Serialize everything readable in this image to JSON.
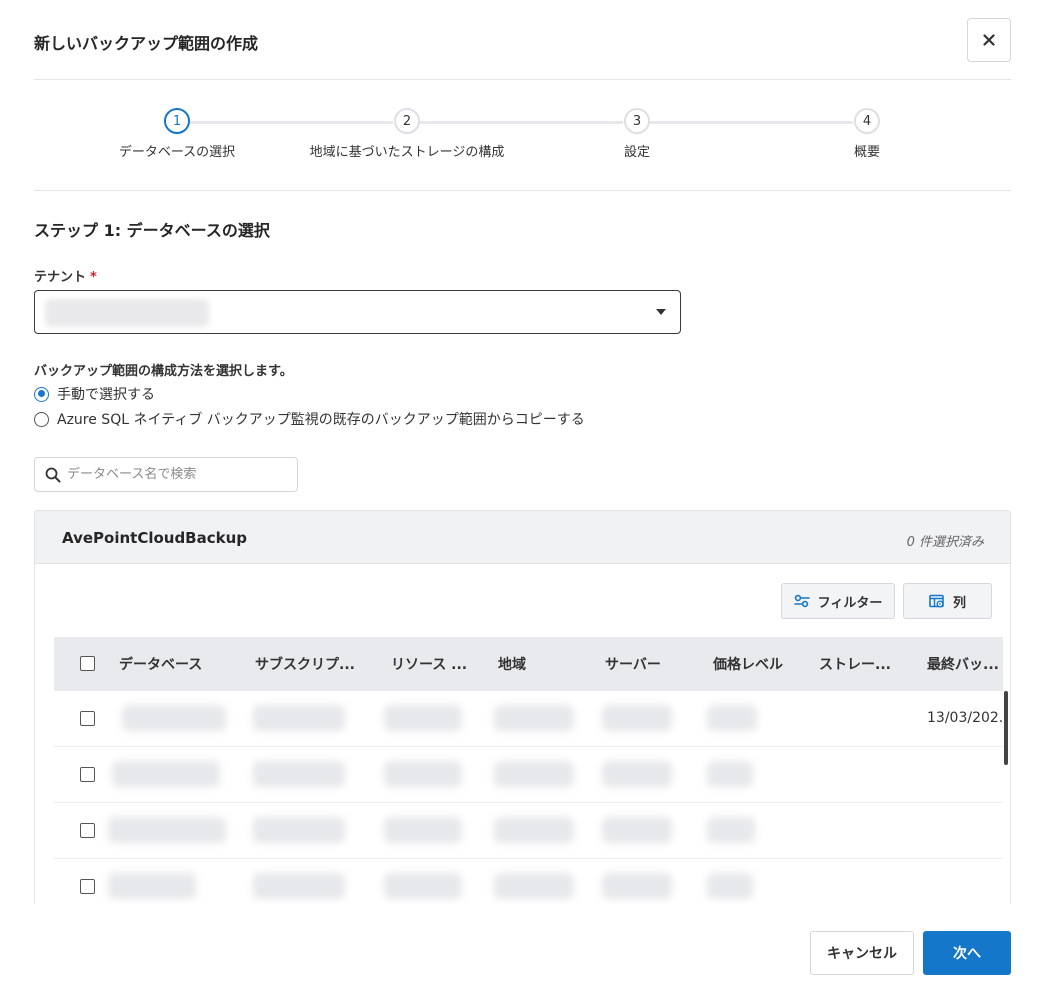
{
  "dialog": {
    "title": "新しいバックアップ範囲の作成",
    "close_icon": "close-icon"
  },
  "steps": [
    {
      "number": "1",
      "label": "データベースの選択",
      "active": true
    },
    {
      "number": "2",
      "label": "地域に基づいたストレージの構成",
      "active": false
    },
    {
      "number": "3",
      "label": "設定",
      "active": false
    },
    {
      "number": "4",
      "label": "概要",
      "active": false
    }
  ],
  "section": {
    "title": "ステップ 1: データベースの選択"
  },
  "tenant": {
    "label": "テナント",
    "required_mark": "*"
  },
  "method": {
    "label": "バックアップ範囲の構成方法を選択します。",
    "options": [
      {
        "label": "手動で選択する",
        "checked": true
      },
      {
        "label": "Azure SQL ネイティブ バックアップ監視の既存のバックアップ範囲からコピーする",
        "checked": false
      }
    ]
  },
  "search": {
    "placeholder": "データベース名で検索",
    "value": ""
  },
  "panel": {
    "title": "AvePointCloudBackup",
    "selected_count": "0 件選択済み",
    "filter_label": "フィルター",
    "columns_label": "列"
  },
  "grid": {
    "columns": [
      "データベース",
      "サブスクリプ...",
      "リソース ...",
      "地域",
      "サーバー",
      "価格レベル",
      "ストレー...",
      "最終バッ..."
    ],
    "rows": [
      {
        "last_backup": "13/03/202..."
      },
      {
        "last_backup": ""
      },
      {
        "last_backup": ""
      },
      {
        "last_backup": ""
      }
    ]
  },
  "footer": {
    "cancel_label": "キャンセル",
    "next_label": "次へ"
  },
  "colors": {
    "accent": "#1477c9",
    "required": "#d0202a",
    "header_bg": "#f1f2f4",
    "grid_header_bg": "#e9eaed"
  }
}
